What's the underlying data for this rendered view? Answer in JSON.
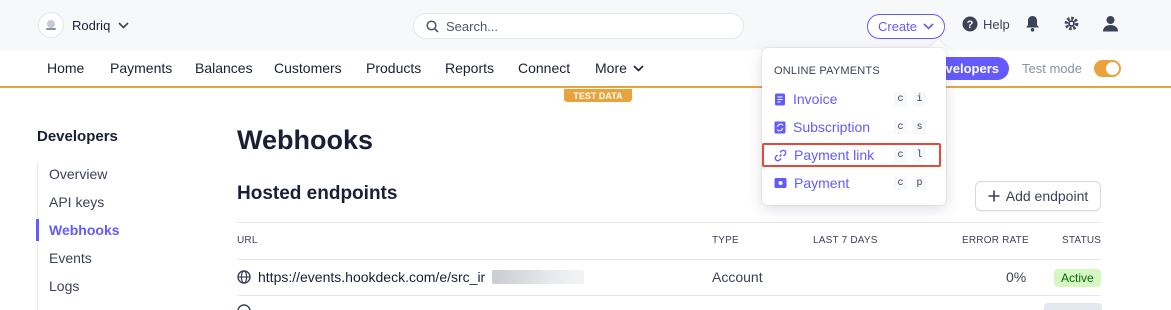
{
  "topbar": {
    "account_name": "Rodriq",
    "search_placeholder": "Search...",
    "create_label": "Create",
    "help_label": "Help"
  },
  "nav": {
    "items": [
      "Home",
      "Payments",
      "Balances",
      "Customers",
      "Products",
      "Reports",
      "Connect",
      "More"
    ],
    "developers_label": "Developers",
    "developers_visible": "velopers",
    "test_mode_label": "Test mode",
    "test_data_badge": "TEST DATA"
  },
  "sidebar": {
    "title": "Developers",
    "items": [
      "Overview",
      "API keys",
      "Webhooks",
      "Events",
      "Logs"
    ],
    "active": "Webhooks"
  },
  "main": {
    "title": "Webhooks",
    "section_title": "Hosted endpoints",
    "add_button": "Add endpoint",
    "columns": [
      "URL",
      "TYPE",
      "LAST 7 DAYS",
      "ERROR RATE",
      "STATUS"
    ],
    "rows": [
      {
        "url": "https://events.hookdeck.com/e/src_ir",
        "type": "Account",
        "last_7_days": "",
        "error_rate": "0%",
        "status": "Active"
      }
    ]
  },
  "create_menu": {
    "heading": "ONLINE PAYMENTS",
    "items": [
      {
        "label": "Invoice",
        "key1": "c",
        "key2": "i",
        "icon": "invoice-icon"
      },
      {
        "label": "Subscription",
        "key1": "c",
        "key2": "s",
        "icon": "subscription-icon"
      },
      {
        "label": "Payment link",
        "key1": "c",
        "key2": "l",
        "icon": "link-icon"
      },
      {
        "label": "Payment",
        "key1": "c",
        "key2": "p",
        "icon": "payment-icon"
      }
    ],
    "highlighted": "Payment link"
  },
  "colors": {
    "accent": "#635bff",
    "test_mode": "#e8a33c",
    "highlight": "#e5493a",
    "active_badge_bg": "#d7f7c2"
  }
}
